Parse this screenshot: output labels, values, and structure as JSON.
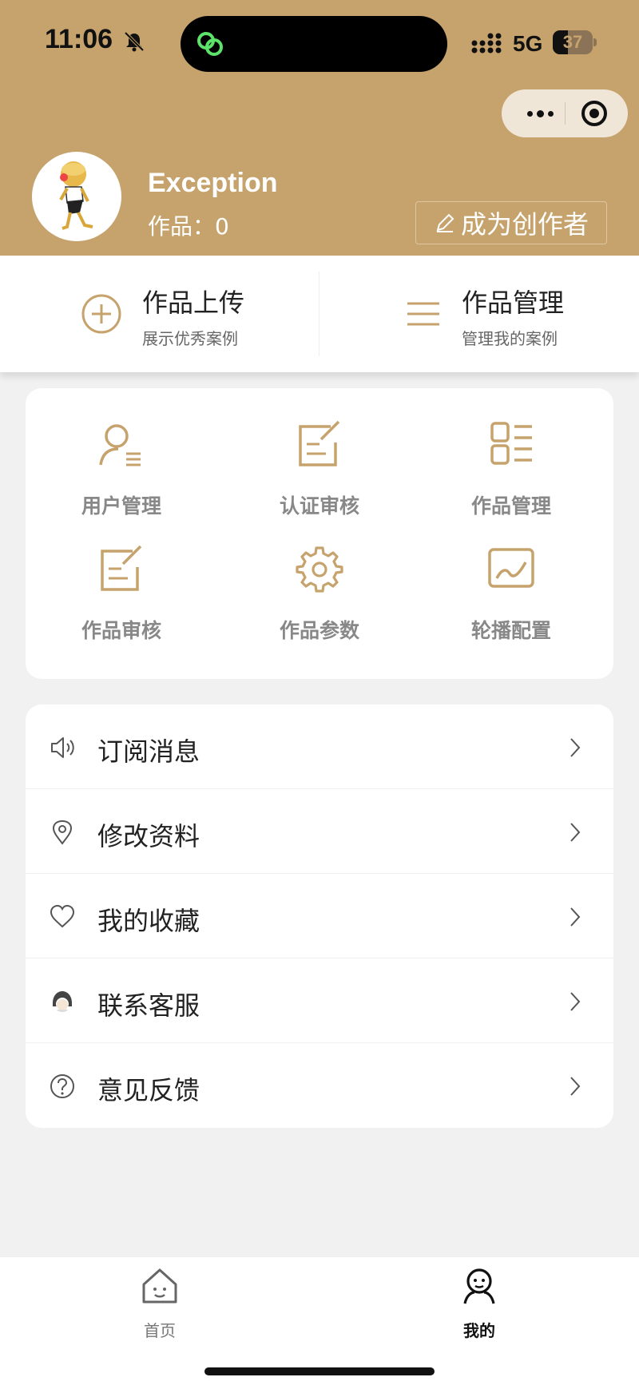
{
  "status_bar": {
    "time": "11:06",
    "network": "5G",
    "battery": "37",
    "battery_level": 0.37
  },
  "capsule": {
    "more_icon": "more-dots-icon",
    "close_icon": "target-icon"
  },
  "profile": {
    "username": "Exception",
    "works_count": "作品：0",
    "become_creator": "成为创作者"
  },
  "quick_actions": [
    {
      "title": "作品上传",
      "subtitle": "展示优秀案例",
      "icon": "plus-circle-icon"
    },
    {
      "title": "作品管理",
      "subtitle": "管理我的案例",
      "icon": "menu-lines-icon"
    }
  ],
  "admin_grid": [
    {
      "label": "用户管理",
      "icon": "user-list-icon"
    },
    {
      "label": "认证审核",
      "icon": "edit-document-icon"
    },
    {
      "label": "作品管理",
      "icon": "grid-list-icon"
    },
    {
      "label": "作品审核",
      "icon": "edit-document-icon"
    },
    {
      "label": "作品参数",
      "icon": "gear-icon"
    },
    {
      "label": "轮播配置",
      "icon": "image-chart-icon"
    }
  ],
  "menu_list": [
    {
      "label": "订阅消息",
      "icon": "speaker-icon"
    },
    {
      "label": "修改资料",
      "icon": "location-pin-icon"
    },
    {
      "label": "我的收藏",
      "icon": "heart-icon"
    },
    {
      "label": "联系客服",
      "icon": "customer-service-icon"
    },
    {
      "label": "意见反馈",
      "icon": "question-circle-icon"
    }
  ],
  "tab_bar": [
    {
      "label": "首页",
      "icon": "home-icon",
      "active": false
    },
    {
      "label": "我的",
      "icon": "person-icon",
      "active": true
    }
  ],
  "colors": {
    "brand": "#c6a36d",
    "background": "#f1f1f1",
    "icon_gold": "#c6a36d"
  }
}
